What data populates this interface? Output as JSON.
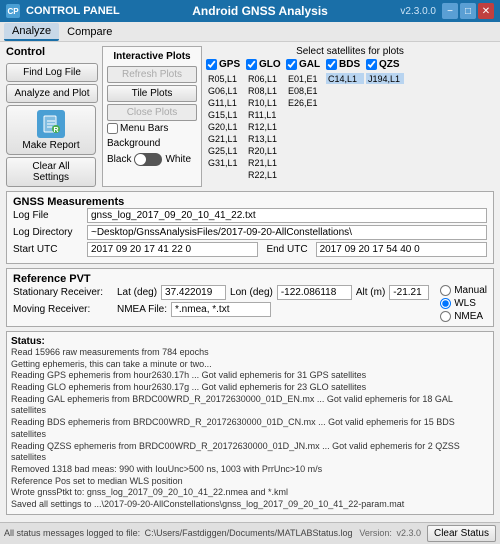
{
  "titleBar": {
    "icon": "CP",
    "appTitle": "CONTROL PANEL",
    "windowTitle": "Android GNSS Analysis",
    "version": "v2.3.0.0",
    "minimizeLabel": "−",
    "maximizeLabel": "□",
    "closeLabel": "✕"
  },
  "menuBar": {
    "items": [
      "Analyze",
      "Compare"
    ]
  },
  "control": {
    "sectionLabel": "Control",
    "findLogButton": "Find Log File",
    "analyzeButton": "Analyze and Plot",
    "makeReportButton": "Make Report",
    "clearAllButton": "Clear All Settings"
  },
  "interactivePlots": {
    "label": "Interactive Plots",
    "refreshButton": "Refresh Plots",
    "tileButton": "Tile Plots",
    "closeButton": "Close Plots",
    "menuBarsLabel": "Menu Bars",
    "backgroundLabel": "Background",
    "blackLabel": "Black",
    "whiteLabel": "White"
  },
  "satellites": {
    "headerLabel": "Select satellites for plots",
    "columns": [
      {
        "id": "GPS",
        "checked": true,
        "cells": [
          "R05,L1",
          "G06,L1",
          "G11,L1",
          "G15,L1",
          "G20,L1",
          "G21,L1",
          "G25,L1",
          "G31,L1"
        ]
      },
      {
        "id": "GLO",
        "checked": true,
        "cells": [
          "R06,L1",
          "R08,L1",
          "R10,L1",
          "R11,L1",
          "R12,L1",
          "R13,L1",
          "R20,L1",
          "R21,L1",
          "R22,L1"
        ]
      },
      {
        "id": "GAL",
        "checked": true,
        "cells": [
          "E01,E1",
          "E08,E1",
          "E26,E1"
        ]
      },
      {
        "id": "BDS",
        "checked": true,
        "cells": [
          "C14,L1"
        ]
      },
      {
        "id": "QZS",
        "checked": true,
        "cells": [
          "J194,L1"
        ]
      }
    ]
  },
  "gnssMeasurements": {
    "sectionLabel": "GNSS Measurements",
    "logFileLabel": "Log File",
    "logFileValue": "gnss_log_2017_09_20_10_41_22.txt",
    "logDirLabel": "Log Directory",
    "logDirValue": "~Desktop/GnssAnalysisFiles/2017-09-20-AllConstellations\\",
    "startUtcLabel": "Start UTC",
    "startUtcValue": "2017 09 20 17 41 22 0",
    "endUtcLabel": "End UTC",
    "endUtcValue": "2017 09 20 17 54 40 0"
  },
  "referencePVT": {
    "sectionLabel": "Reference PVT",
    "stationaryLabel": "Stationary Receiver:",
    "latLabel": "Lat (deg)",
    "latValue": "37.422019",
    "lonLabel": "Lon (deg)",
    "lonValue": "-122.086118",
    "altLabel": "Alt (m)",
    "altValue": "-21.21",
    "movingLabel": "Moving Receiver:",
    "nmeaLabel": "NMEA File:",
    "nmeaValue": "*.nmea, *.txt",
    "radioManual": "Manual",
    "radioWLS": "WLS",
    "radioNMEA": "NMEA"
  },
  "status": {
    "sectionLabel": "Status:",
    "lines": [
      "Read 15966 raw measurements from 784 epochs",
      "Getting ephemeris, this can take a minute or two...",
      "Reading GPS ephemeris from hour2630.17h ... Got valid ephemeris for 31 GPS satellites",
      "Reading GLO ephemeris from hour2630.17g ... Got valid ephemeris for 23 GLO satellites",
      "Reading GAL ephemeris from BRDC00WRD_R_20172630000_01D_EN.mx ... Got valid ephemeris for 18 GAL satellites",
      "Reading BDS ephemeris from BRDC00WRD_R_20172630000_01D_CN.mx ... Got valid ephemeris for 15 BDS satellites",
      "Reading QZSS ephemeris from BRDC00WRD_R_20172630000_01D_JN.mx ... Got valid ephemeris for 2 QZSS satellites",
      "Removed 1318 bad meas: 990 with IouUnc>500 ns, 1003 with PrrUnc>10 m/s",
      "Reference Pos set to median WLS position",
      "Wrote gnssPtkt to: gnss_log_2017_09_20_10_41_22.nmea and *.kml",
      "Saved all settings to ...\\2017-09-20-AllConstellations\\gnss_log_2017_09_20_10_41_22-param.mat"
    ]
  },
  "bottomBar": {
    "logPath": "C:\\Users/Fastdiggen/Documents/MATLABStatus.log",
    "allMessagesLabel": "All status messages logged to file:",
    "versionLabel": "Version:",
    "versionValue": "v2.3.0",
    "clearStatusLabel": "Clear Status"
  }
}
